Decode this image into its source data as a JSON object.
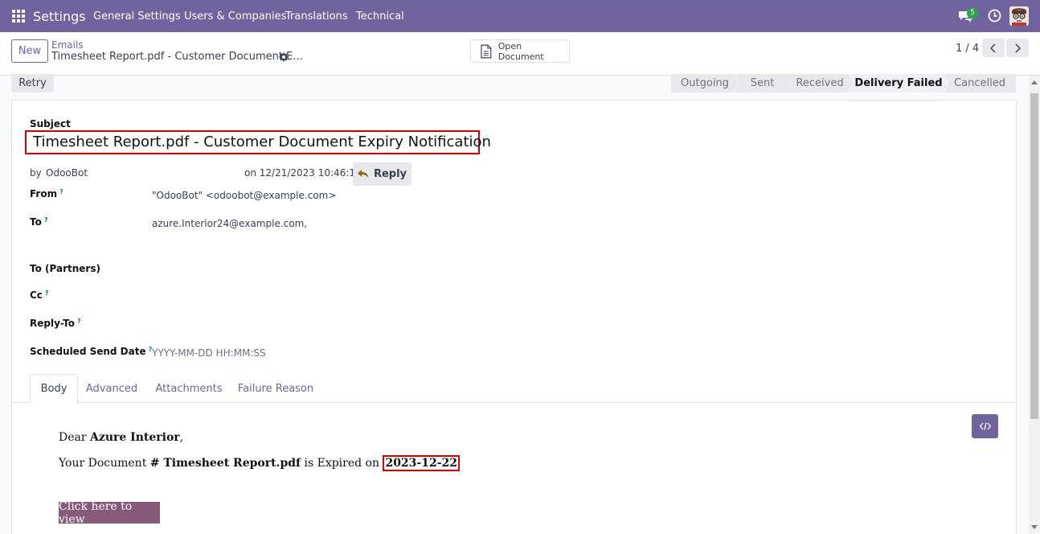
{
  "navbar": {
    "app_name": "Settings",
    "menu": [
      "General Settings",
      "Users & Companies",
      "Translations",
      "Technical"
    ],
    "chat_count": "5"
  },
  "control_panel": {
    "new_label": "New",
    "breadcrumb_parent": "Emails",
    "breadcrumb_current": "Timesheet Report.pdf - Customer Document E…",
    "open_document_label": "Open Document",
    "pager": "1 / 4"
  },
  "statusbar": {
    "retry_label": "Retry",
    "stages": [
      "Outgoing",
      "Sent",
      "Received",
      "Delivery Failed",
      "Cancelled"
    ],
    "active_stage": "Delivery Failed"
  },
  "form": {
    "subject_label": "Subject",
    "subject": "Timesheet Report.pdf - Customer Document Expiry Notification",
    "by_label": "by",
    "author": "OdooBot",
    "date": "on 12/21/2023 10:46:19",
    "reply_label": "Reply",
    "from_label": "From",
    "from_value": "\"OdooBot\" <odoobot@example.com>",
    "to_label": "To",
    "to_value": "azure.Interior24@example.com,",
    "to_partners_label": "To (Partners)",
    "cc_label": "Cc",
    "reply_to_label": "Reply-To",
    "scheduled_label": "Scheduled Send Date",
    "scheduled_placeholder": "YYYY-MM-DD HH:MM:SS",
    "help_mark": "?"
  },
  "tabs": [
    "Body",
    "Advanced",
    "Attachments",
    "Failure Reason"
  ],
  "active_tab": "Body",
  "body": {
    "greeting_prefix": "Dear ",
    "customer": "Azure Interior",
    "greeting_suffix": ",",
    "line_prefix": "Your Document ",
    "doc_name": "# Timesheet Report.pdf",
    "line_mid": " is Expired on ",
    "expiry_date": "2023-12-22",
    "view_button": "Click here to view"
  },
  "colors": {
    "brand": "#71639e",
    "highlight_border": "#dd0000",
    "view_button": "#875a7b"
  }
}
